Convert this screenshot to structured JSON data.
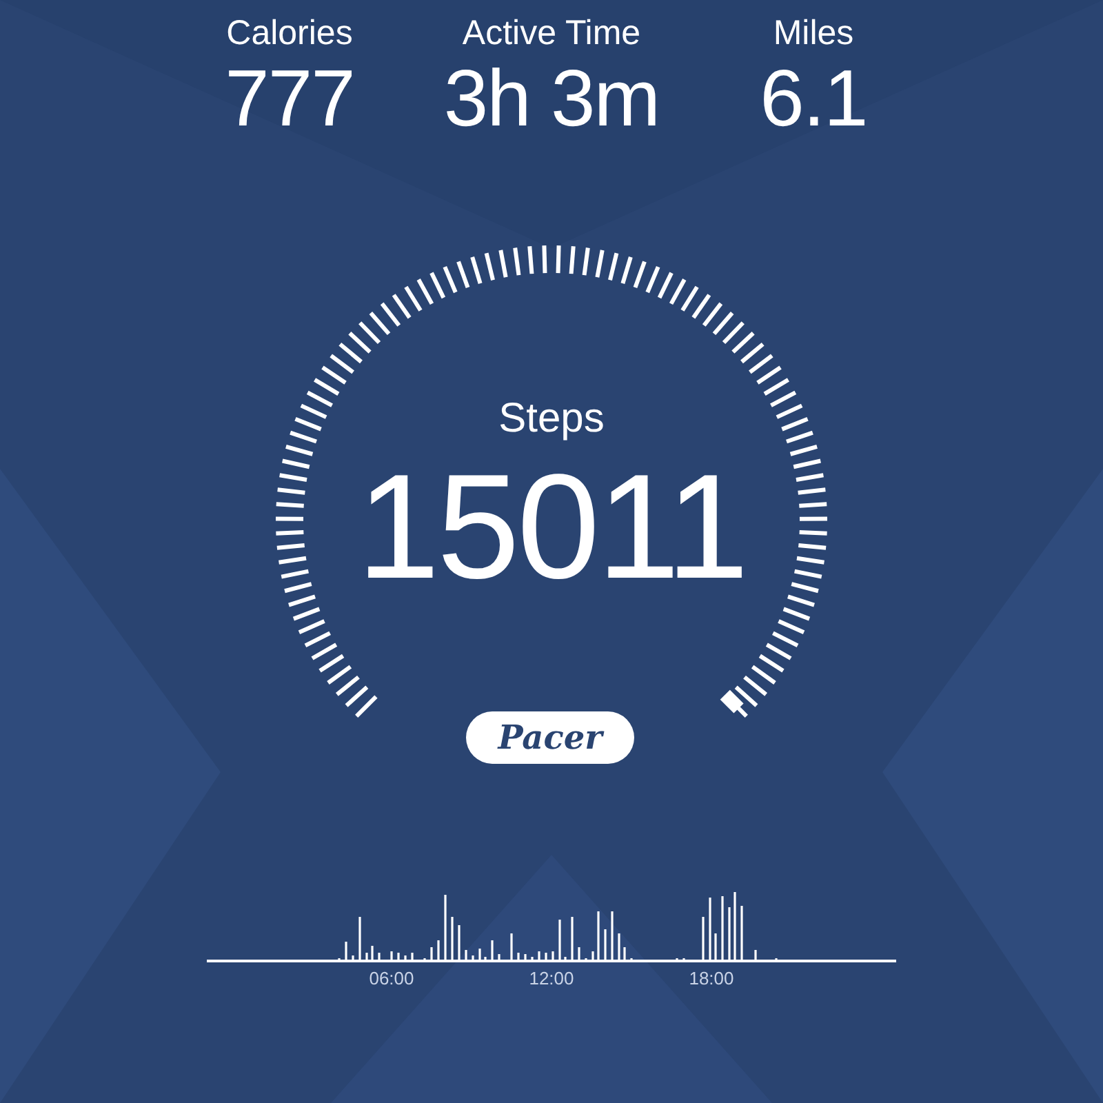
{
  "stats": [
    {
      "label": "Calories",
      "value": "777"
    },
    {
      "label": "Active Time",
      "value": "3h 3m"
    },
    {
      "label": "Miles",
      "value": "6.1"
    }
  ],
  "steps": {
    "label": "Steps",
    "value": "15011"
  },
  "logo": "Pacer",
  "activity": {
    "time_labels": [
      "06:00",
      "12:00",
      "18:00"
    ]
  }
}
